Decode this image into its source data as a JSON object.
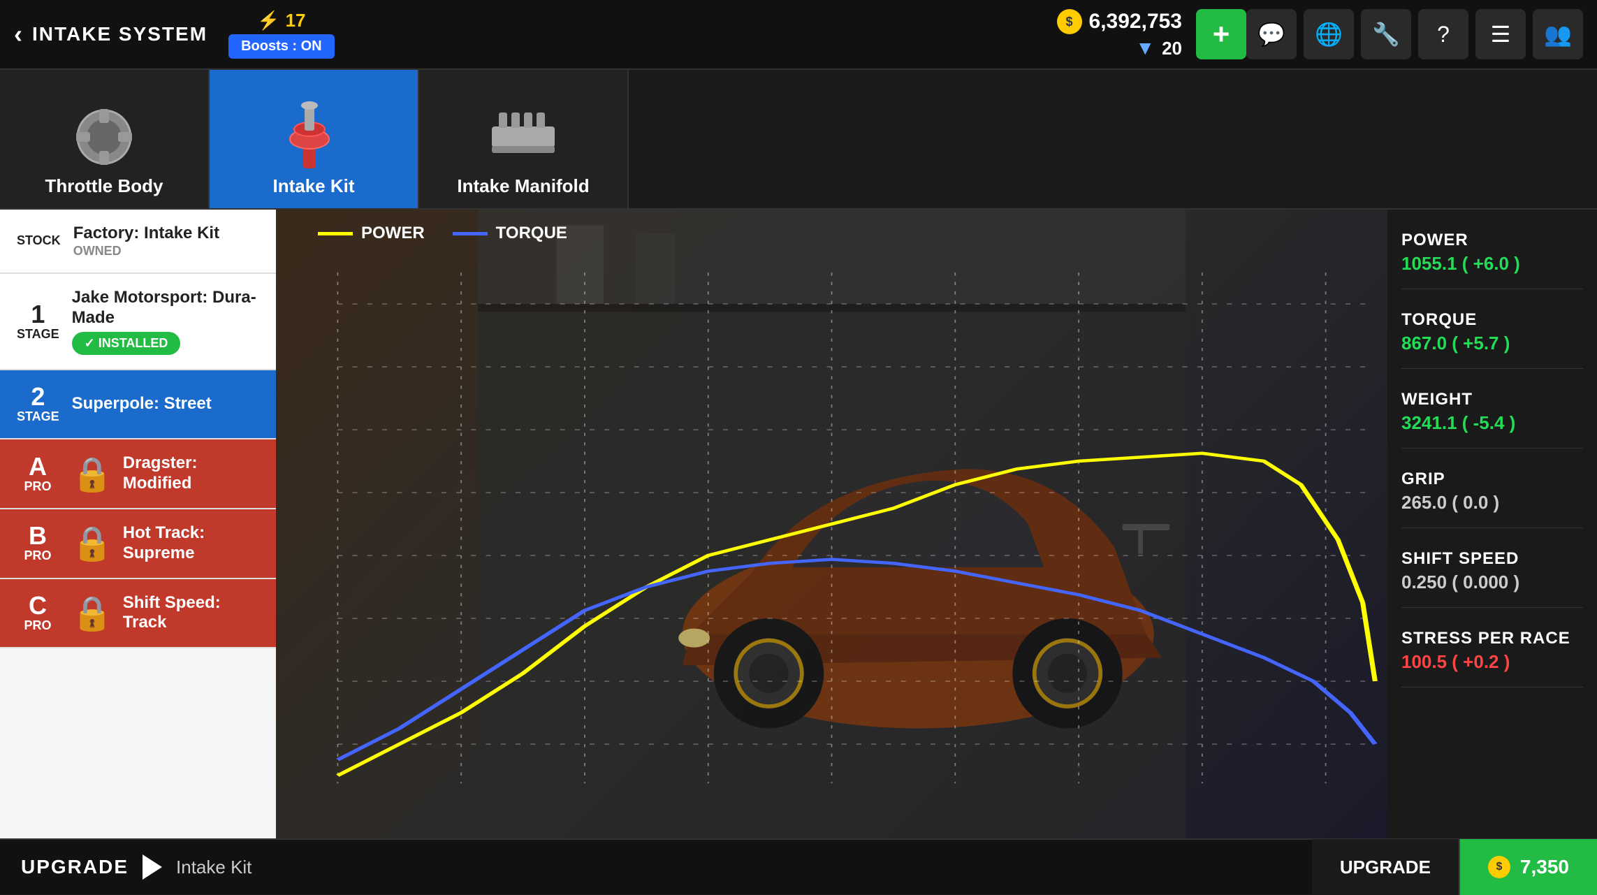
{
  "header": {
    "back_label": "INTAKE SYSTEM",
    "lightning_count": "17",
    "boost_label": "Boosts : ON",
    "gold": "6,392,753",
    "diamonds": "20",
    "add_button_label": "+",
    "icons": [
      "chat",
      "globe",
      "wrench",
      "question",
      "menu",
      "people"
    ]
  },
  "tabs": [
    {
      "id": "throttle-body",
      "label": "Throttle Body",
      "active": false
    },
    {
      "id": "intake-kit",
      "label": "Intake Kit",
      "active": true
    },
    {
      "id": "intake-manifold",
      "label": "Intake Manifold",
      "active": false
    }
  ],
  "upgrades": [
    {
      "id": "stock",
      "stage_label": "STOCK",
      "name": "Factory: Intake Kit",
      "sub": "OWNED",
      "state": "stock"
    },
    {
      "id": "stage1",
      "stage_number": "1",
      "stage_label": "STAGE",
      "name": "Jake Motorsport: Dura-Made",
      "sub": "",
      "installed": true,
      "state": "installed"
    },
    {
      "id": "stage2",
      "stage_number": "2",
      "stage_label": "STAGE",
      "name": "Superpole: Street",
      "sub": "",
      "installed": false,
      "state": "selected"
    },
    {
      "id": "pro-a",
      "stage_number": "A",
      "stage_label": "PRO",
      "name": "Dragster: Modified",
      "sub": "",
      "installed": false,
      "state": "locked"
    },
    {
      "id": "pro-b",
      "stage_number": "B",
      "stage_label": "PRO",
      "name": "Hot Track: Supreme",
      "sub": "",
      "installed": false,
      "state": "locked"
    },
    {
      "id": "pro-c",
      "stage_number": "C",
      "stage_label": "PRO",
      "name": "Shift Speed: Track",
      "sub": "",
      "installed": false,
      "state": "locked"
    }
  ],
  "installed_label": "✓ INSTALLED",
  "chart": {
    "power_label": "POWER",
    "torque_label": "TORQUE"
  },
  "stats": [
    {
      "name": "POWER",
      "value": "1055.1 ( +6.0 )",
      "class": "positive"
    },
    {
      "name": "TORQUE",
      "value": "867.0 ( +5.7 )",
      "class": "positive"
    },
    {
      "name": "WEIGHT",
      "value": "3241.1 ( -5.4 )",
      "class": "positive"
    },
    {
      "name": "GRIP",
      "value": "265.0 ( 0.0 )",
      "class": "neutral"
    },
    {
      "name": "SHIFT SPEED",
      "value": "0.250 ( 0.000 )",
      "class": "neutral"
    },
    {
      "name": "STRESS PER RACE",
      "value": "100.5 ( +0.2 )",
      "class": "negative"
    }
  ],
  "bottom": {
    "upgrade_label": "UPGRADE",
    "upgrade_item": "Intake Kit",
    "upgrade_btn_label": "UPGRADE",
    "cost": "7,350"
  }
}
